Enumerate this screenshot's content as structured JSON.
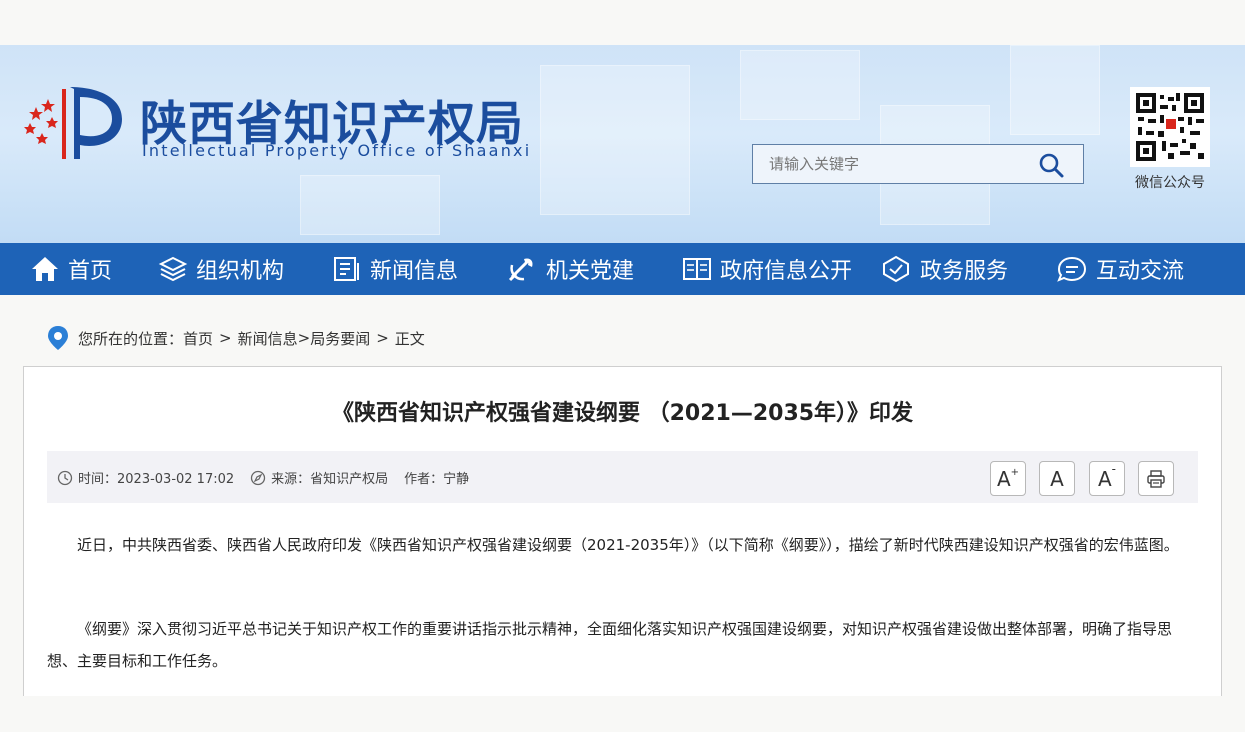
{
  "header": {
    "title": "陕西省知识产权局",
    "subtitle": "Intellectual Property Office of Shaanxi",
    "search_placeholder": "请输入关键字",
    "qr_label": "微信公众号"
  },
  "nav": {
    "items": [
      {
        "label": "首页",
        "icon": "home-icon"
      },
      {
        "label": "组织机构",
        "icon": "layers-icon"
      },
      {
        "label": "新闻信息",
        "icon": "news-icon"
      },
      {
        "label": "机关党建",
        "icon": "party-emblem-icon"
      },
      {
        "label": "政府信息公开",
        "icon": "book-icon"
      },
      {
        "label": "政务服务",
        "icon": "service-icon"
      },
      {
        "label": "互动交流",
        "icon": "chat-icon"
      }
    ]
  },
  "breadcrumb": {
    "prefix": "您所在的位置：",
    "home": "首页",
    "sep": ">",
    "news": "新闻信息",
    "section": "局务要闻",
    "current": "正文"
  },
  "article": {
    "title": "《陕西省知识产权强省建设纲要 （2021—2035年）》印发",
    "meta": {
      "time": "时间：2023-03-02 17:02",
      "source": "来源：省知识产权局",
      "author": "作者：宁静"
    },
    "tools": {
      "increase": "A",
      "normal": "A",
      "decrease": "A",
      "plus": "+",
      "minus": "-"
    },
    "paragraphs": [
      "近日，中共陕西省委、陕西省人民政府印发《陕西省知识产权强省建设纲要（2021-2035年）》（以下简称《纲要》），描绘了新时代陕西建设知识产权强省的宏伟蓝图。",
      "《纲要》深入贯彻习近平总书记关于知识产权工作的重要讲话指示批示精神，全面细化落实知识产权强国建设纲要，对知识产权强省建设做出整体部署，明确了指导思想、主要目标和工作任务。"
    ]
  },
  "colors": {
    "nav_bg": "#1e63b7",
    "title_blue": "#1b4d9e",
    "logo_red": "#d9261c"
  }
}
